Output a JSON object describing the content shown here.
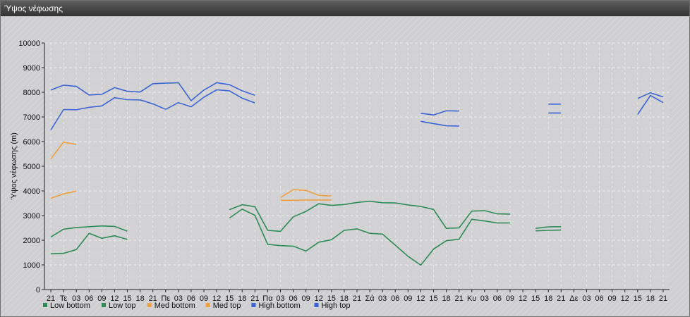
{
  "window": {
    "title": "Ύψος νέφωσης"
  },
  "colors": {
    "low": "#2e8b57",
    "med": "#f0a040",
    "high": "#3b64d4",
    "plot_bg": "#d2d2d4",
    "grid": "#eeeeee"
  },
  "chart_data": {
    "type": "line",
    "title": "",
    "ylabel": "Ύψος νέφωσης (m)",
    "xlabel": "",
    "ylim": [
      0,
      10000
    ],
    "yticks": [
      0,
      1000,
      2000,
      3000,
      4000,
      5000,
      6000,
      7000,
      8000,
      9000,
      10000
    ],
    "grid": true,
    "legend_position": "bottom-left",
    "categories": [
      "21",
      "Τε",
      "03",
      "06",
      "09",
      "12",
      "15",
      "18",
      "21",
      "Πε",
      "03",
      "06",
      "09",
      "12",
      "15",
      "18",
      "21",
      "Πα",
      "03",
      "06",
      "09",
      "12",
      "15",
      "18",
      "21",
      "Σά",
      "03",
      "06",
      "09",
      "12",
      "15",
      "18",
      "21",
      "Κυ",
      "03",
      "06",
      "09",
      "12",
      "15",
      "18",
      "21",
      "Δε",
      "03",
      "06",
      "09",
      "12",
      "15",
      "18",
      "21"
    ],
    "series": [
      {
        "name": "Low bottom",
        "color": "#2e8b57",
        "values": [
          1450,
          1470,
          1620,
          2280,
          2080,
          2180,
          2030,
          null,
          null,
          null,
          null,
          null,
          null,
          null,
          2900,
          3260,
          3010,
          1830,
          1780,
          1760,
          1560,
          1920,
          2020,
          2400,
          2460,
          2280,
          2250,
          1800,
          1350,
          990,
          1640,
          1980,
          2040,
          2850,
          2780,
          2700,
          2700,
          null,
          2380,
          2400,
          2410,
          null,
          null,
          null,
          null,
          null,
          null,
          null,
          null
        ]
      },
      {
        "name": "Low top",
        "color": "#2e8b57",
        "values": [
          2130,
          2450,
          2510,
          2550,
          2580,
          2560,
          2370,
          null,
          null,
          null,
          null,
          null,
          null,
          null,
          3240,
          3440,
          3360,
          2400,
          2360,
          2950,
          3170,
          3480,
          3410,
          3450,
          3530,
          3580,
          3520,
          3510,
          3430,
          3370,
          3250,
          2480,
          2500,
          3180,
          3200,
          3070,
          3060,
          null,
          2480,
          2540,
          2550,
          null,
          null,
          null,
          null,
          null,
          null,
          null,
          null
        ]
      },
      {
        "name": "Med bottom",
        "color": "#f0a040",
        "values": [
          3700,
          3880,
          3990,
          null,
          null,
          null,
          null,
          null,
          null,
          null,
          null,
          null,
          null,
          null,
          null,
          null,
          null,
          null,
          3620,
          3620,
          3630,
          3630,
          3630,
          null,
          null,
          null,
          null,
          null,
          null,
          null,
          null,
          null,
          null,
          null,
          null,
          null,
          null,
          null,
          null,
          null,
          null,
          null,
          null,
          null,
          null,
          null,
          null,
          null,
          null
        ]
      },
      {
        "name": "Med top",
        "color": "#f0a040",
        "values": [
          5300,
          5980,
          5880,
          null,
          null,
          null,
          null,
          null,
          null,
          null,
          null,
          null,
          null,
          null,
          null,
          null,
          null,
          null,
          3730,
          4050,
          4020,
          3820,
          3790,
          null,
          null,
          null,
          null,
          null,
          null,
          null,
          null,
          null,
          null,
          null,
          null,
          null,
          null,
          null,
          null,
          null,
          null,
          null,
          null,
          null,
          null,
          null,
          null,
          null,
          null
        ]
      },
      {
        "name": "High bottom",
        "color": "#3b64d4",
        "values": [
          6470,
          7300,
          7290,
          7390,
          7450,
          7780,
          7700,
          7690,
          7530,
          7310,
          7580,
          7410,
          7800,
          8100,
          8060,
          7760,
          7570,
          null,
          null,
          null,
          null,
          null,
          null,
          null,
          null,
          null,
          null,
          null,
          null,
          6820,
          6730,
          6640,
          6630,
          null,
          null,
          null,
          null,
          null,
          null,
          7160,
          7160,
          null,
          null,
          null,
          null,
          null,
          7100,
          7870,
          7580
        ]
      },
      {
        "name": "High top",
        "color": "#3b64d4",
        "values": [
          8090,
          8290,
          8240,
          7890,
          7920,
          8190,
          8040,
          8010,
          8350,
          8370,
          8390,
          7660,
          8090,
          8390,
          8310,
          8060,
          7880,
          null,
          null,
          null,
          null,
          null,
          null,
          null,
          null,
          null,
          null,
          null,
          null,
          7150,
          7080,
          7250,
          7240,
          null,
          null,
          null,
          null,
          null,
          null,
          7520,
          7520,
          null,
          null,
          null,
          null,
          null,
          7750,
          7980,
          7810
        ]
      }
    ]
  }
}
